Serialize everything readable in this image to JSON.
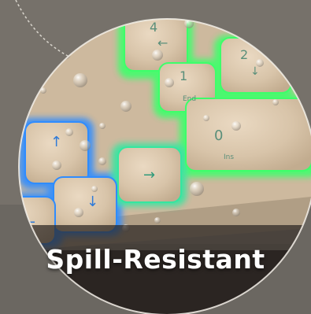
{
  "image": {
    "caption": "Spill-Resistant",
    "keys": [
      {
        "id": "key-4",
        "label": "4",
        "sublabel": "",
        "arrow": "←",
        "glow": "#3dff6a"
      },
      {
        "id": "key-2",
        "label": "2",
        "sublabel": "",
        "arrow": "↓",
        "glow": "#3dff6a"
      },
      {
        "id": "key-1",
        "label": "1",
        "sublabel": "End",
        "arrow": "",
        "glow": "#3dff6a"
      },
      {
        "id": "key-0",
        "label": "0",
        "sublabel": "Ins",
        "arrow": "",
        "glow": "#3dff6a"
      },
      {
        "id": "key-up",
        "label": "",
        "sublabel": "",
        "arrow": "↑",
        "glow": "#2f8cff"
      },
      {
        "id": "key-down",
        "label": "",
        "sublabel": "",
        "arrow": "↓",
        "glow": "#2f8cff"
      },
      {
        "id": "key-right",
        "label": "",
        "sublabel": "",
        "arrow": "→",
        "glow": "#35e6a0"
      },
      {
        "id": "key-left",
        "label": "",
        "sublabel": "",
        "arrow": "←",
        "glow": "#2f8cff"
      }
    ],
    "colors": {
      "keycap": "#d9c6ac",
      "keyboard_body": "#cbb79c",
      "desk": "#8c8275",
      "background": "#6a6660",
      "caption_band": "#2b2623",
      "accent_green": "#3dff6a",
      "accent_blue": "#2f8cff"
    }
  }
}
